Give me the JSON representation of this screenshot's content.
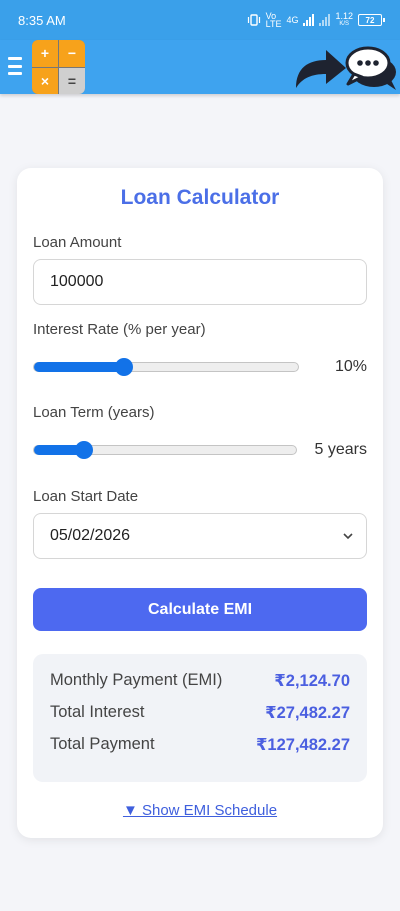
{
  "status_bar": {
    "time": "8:35 AM",
    "network_label_1": "Vo",
    "network_label_2": "LTE",
    "network_label_3": "4G",
    "speed_value": "1.12",
    "speed_unit": "K/S",
    "battery": "72"
  },
  "app_bar": {
    "logo_symbols": [
      "+",
      "−",
      "×",
      "="
    ]
  },
  "calculator": {
    "title": "Loan Calculator",
    "loan_amount_label": "Loan Amount",
    "loan_amount_value": "100000",
    "interest_rate_label": "Interest Rate (% per year)",
    "interest_rate_value": "10%",
    "interest_rate_fraction": 0.34,
    "loan_term_label": "Loan Term (years)",
    "loan_term_value": "5 years",
    "loan_term_fraction": 0.19,
    "start_date_label": "Loan Start Date",
    "start_date_value": "05/02/2026",
    "calculate_label": "Calculate EMI"
  },
  "results": {
    "emi_label": "Monthly Payment (EMI)",
    "emi_value": "₹2,124.70",
    "interest_label": "Total Interest",
    "interest_value": "₹27,482.27",
    "payment_label": "Total Payment",
    "payment_value": "₹127,482.27"
  },
  "schedule_link": "▼ Show EMI Schedule",
  "colors": {
    "primary": "#4d69f0",
    "title": "#4b6fe7",
    "slider": "#1272e8",
    "app_bar": "#3ea3ef"
  }
}
